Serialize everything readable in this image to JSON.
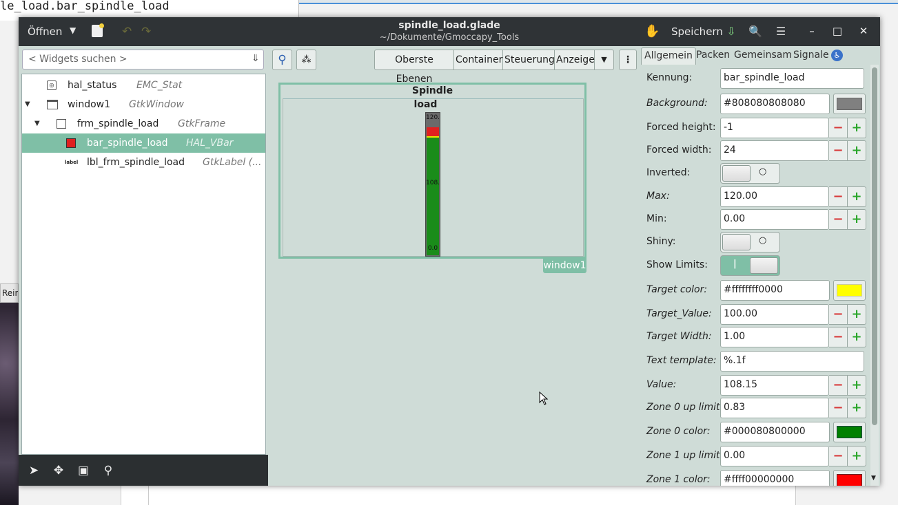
{
  "background": {
    "terminal_text": "le_load.bar_spindle_load",
    "side_tab_label": "Rein"
  },
  "headerbar": {
    "open_label": "Öffnen",
    "title": "spindle_load.glade",
    "subtitle": "~/Dokumente/Gmoccapy_Tools",
    "save_label": "Speichern"
  },
  "search": {
    "placeholder": "< Widgets suchen >"
  },
  "tree": {
    "rows": [
      {
        "name": "hal_status",
        "type": "EMC_Stat"
      },
      {
        "name": "window1",
        "type": "GtkWindow"
      },
      {
        "name": "frm_spindle_load",
        "type": "GtkFrame"
      },
      {
        "name": "bar_spindle_load",
        "type": "HAL_VBar"
      },
      {
        "name": "lbl_frm_spindle_load",
        "type": "GtkLabel (..."
      }
    ],
    "selected": "bar_spindle_load",
    "label_icon_text": "label"
  },
  "palette": {
    "groups": [
      "Oberste Ebenen",
      "Container",
      "Steuerung",
      "Anzeige"
    ]
  },
  "preview": {
    "frame_label": "Spindle\nload",
    "frame_label_line1": "Spindle",
    "frame_label_line2": "load",
    "bar_max_text": "120.0",
    "bar_value_text": "108.2",
    "bar_min_text": "0.0",
    "window_tag": "window1",
    "bar_level": {
      "max": 120,
      "value": 108.15,
      "target": 100,
      "zone0_up": 0.83
    }
  },
  "tabs": [
    "Allgemein",
    "Packen",
    "Gemeinsam",
    "Signale"
  ],
  "properties": {
    "kennung": {
      "label": "Kennung:",
      "value": "bar_spindle_load"
    },
    "background": {
      "label": "Background:",
      "value": "#808080808080",
      "color": "#808080"
    },
    "forced_height": {
      "label": "Forced height:",
      "value": "-1"
    },
    "forced_width": {
      "label": "Forced width:",
      "value": "24"
    },
    "inverted": {
      "label": "Inverted:",
      "state": "off"
    },
    "max": {
      "label": "Max:",
      "value": "120.00"
    },
    "min": {
      "label": "Min:",
      "value": "0.00"
    },
    "shiny": {
      "label": "Shiny:",
      "state": "off"
    },
    "show_limits": {
      "label": "Show Limits:",
      "state": "on"
    },
    "target_color": {
      "label": "Target color:",
      "value": "#ffffffff0000",
      "color": "#ffff00"
    },
    "target_value": {
      "label": "Target_Value:",
      "value": "100.00"
    },
    "target_width": {
      "label": "Target Width:",
      "value": "1.00"
    },
    "text_template": {
      "label": "Text template:",
      "value": "%.1f"
    },
    "value": {
      "label": "Value:",
      "value": "108.15"
    },
    "zone0_up": {
      "label": "Zone 0 up limit:",
      "value": "0.83"
    },
    "zone0_color": {
      "label": "Zone 0 color:",
      "value": "#000080800000",
      "color": "#008000"
    },
    "zone1_up": {
      "label": "Zone 1 up limit:",
      "value": "0.00"
    },
    "zone1_color": {
      "label": "Zone 1 color:",
      "value": "#ffff00000000",
      "color": "#ff0000"
    }
  }
}
